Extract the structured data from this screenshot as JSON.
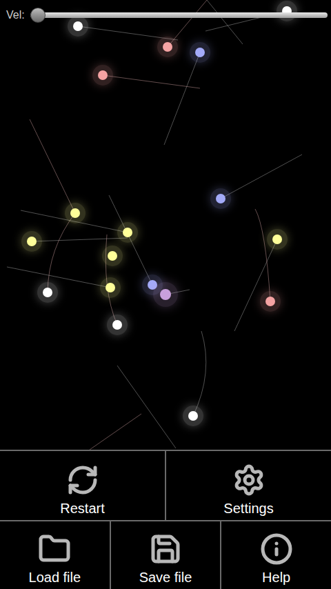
{
  "slider": {
    "label": "Vel:",
    "level": 0
  },
  "particles": [
    {
      "color": "#ffffff"
    },
    {
      "color": "#f4a3a3"
    },
    {
      "color": "#a3aaf8"
    },
    {
      "color": "#f4a3a3"
    },
    {
      "color": "#ffffff"
    },
    {
      "color": "#a3aaf8"
    },
    {
      "color": "#ffff99"
    },
    {
      "color": "#ffff99"
    },
    {
      "color": "#ffff99"
    },
    {
      "color": "#ffff99"
    },
    {
      "color": "#ffff99"
    },
    {
      "color": "#ffffff"
    },
    {
      "color": "#ffff99"
    },
    {
      "color": "#a3aaf8"
    },
    {
      "color": "#c9a0dc"
    },
    {
      "color": "#f4a3a3"
    },
    {
      "color": "#ffffff"
    },
    {
      "color": "#ffffff"
    }
  ],
  "menu": {
    "rows": [
      [
        {
          "label": "Restart"
        },
        {
          "label": "Settings"
        }
      ],
      [
        {
          "label": "Load file"
        },
        {
          "label": "Save file"
        },
        {
          "label": "Help"
        }
      ]
    ]
  }
}
